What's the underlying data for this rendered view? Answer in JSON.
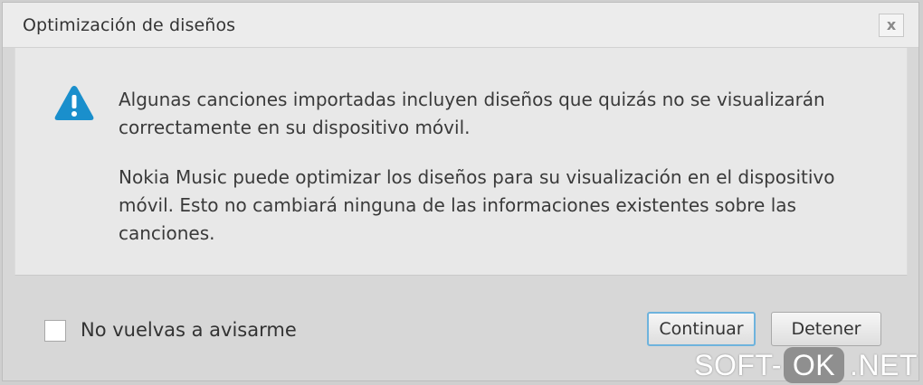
{
  "dialog": {
    "title": "Optimización de diseños",
    "close_label": "x",
    "message": {
      "paragraph1": "Algunas canciones importadas incluyen diseños que quizás no se visualizarán correctamente en su dispositivo móvil.",
      "paragraph2": "Nokia Music puede optimizar los diseños para su visualización en el dispositivo móvil. Esto no cambiará ninguna de las informaciones existentes sobre las canciones."
    },
    "checkbox": {
      "label": "No vuelvas a avisarme",
      "checked": false
    },
    "buttons": {
      "continue_label": "Continuar",
      "stop_label": "Detener"
    },
    "icon": "warning-triangle-icon"
  },
  "watermark": {
    "left": "SOFT-",
    "badge": "OK",
    "right": ".NET"
  },
  "colors": {
    "warning_icon": "#1a8fcc",
    "focus_border": "#6eb3dd"
  }
}
